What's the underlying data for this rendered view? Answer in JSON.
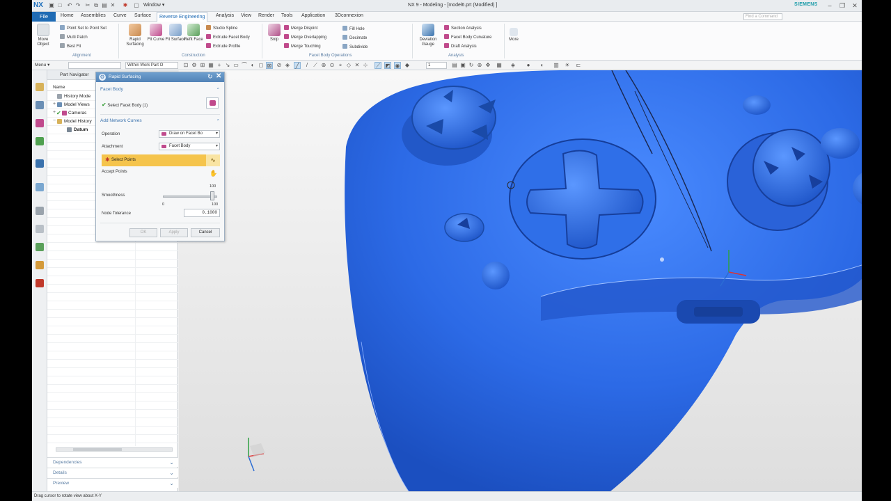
{
  "app": {
    "logo": "NX",
    "title": "NX 9 - Modeling - [model6.prt (Modified) ]",
    "brand": "SIEMENS",
    "window_menu": "Window ▾",
    "find_placeholder": "Find a Command"
  },
  "menu": {
    "file": "File",
    "tabs": [
      "Home",
      "Assemblies",
      "Curve",
      "Surface",
      "Reverse Engineering",
      "Analysis",
      "View",
      "Render",
      "Tools",
      "Application",
      "3Dconnexion"
    ],
    "active_tab": "Reverse Engineering"
  },
  "ribbon": {
    "alignment": {
      "label": "Alignment",
      "move_object": "Move Object",
      "point_set_to_point_set": "Point Set to Point Set",
      "multi_patch": "Multi Patch",
      "best_fit": "Best Fit"
    },
    "construction": {
      "label": "Construction",
      "rapid_surfacing": "Rapid Surfacing",
      "fit_curve": "Fit Curve",
      "fit_surface": "Fit Surface",
      "refit_face": "Refit Face",
      "studio_spline": "Studio Spline",
      "extrude_facet_body": "Extrude Facet Body",
      "extrude_profile": "Extrude Profile"
    },
    "facet_ops": {
      "label": "Facet Body Operations",
      "snip": "Snip",
      "merge_disjoint": "Merge Disjoint",
      "merge_overlapping": "Merge Overlapping",
      "merge_touching": "Merge Touching",
      "fill_hole": "Fill Hole",
      "decimate": "Decimate",
      "subdivide": "Subdivide"
    },
    "analysis": {
      "label": "Analysis",
      "deviation_gauge": "Deviation Gauge",
      "section_analysis": "Section Analysis",
      "facet_body_curvature": "Facet Body Curvature",
      "draft_analysis": "Draft Analysis"
    },
    "more": "More"
  },
  "toolbar": {
    "menu": "Menu ▾",
    "filter": "",
    "scope": "Within Work Part O",
    "count": "1"
  },
  "navigator": {
    "title": "Part Navigator",
    "column": "Name",
    "items": [
      {
        "label": "History Mode"
      },
      {
        "label": "Model Views"
      },
      {
        "label": "Cameras"
      },
      {
        "label": "Model History"
      },
      {
        "label": "Datum"
      }
    ],
    "panels": [
      "Dependencies",
      "Details",
      "Preview"
    ]
  },
  "dialog": {
    "title": "Rapid Surfacing",
    "facet_body_section": "Facet Body",
    "select_facet_body": "Select Facet Body (1)",
    "network_section": "Add Network Curves",
    "operation_label": "Operation",
    "operation_value": "Draw on Facet Bo",
    "attachment_label": "Attachment",
    "attachment_value": "Facet Body",
    "select_points": "Select Points",
    "accept_points": "Accept Points",
    "smoothness_label": "Smoothness",
    "smoothness_max_top": "100",
    "smoothness_min": "0",
    "smoothness_max": "100",
    "smoothness_value": 95,
    "node_tolerance_label": "Node Tolerance",
    "node_tolerance_value": "0.1000",
    "ok": "OK",
    "apply": "Apply",
    "cancel": "Cancel"
  },
  "status": {
    "text": "Drag cursor to rotate view about X-Y"
  },
  "colors": {
    "model_blue": "#2f6fe8",
    "accent": "#1f6bb4",
    "selection_yellow": "#f5c44c"
  }
}
